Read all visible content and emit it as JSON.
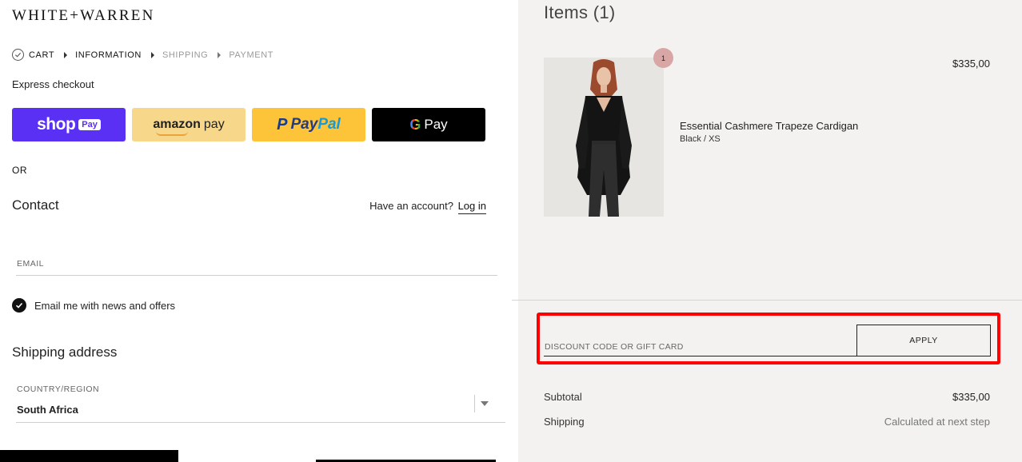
{
  "brand": {
    "logo_text": "WHITE+WARREN"
  },
  "breadcrumb": [
    {
      "label": "CART",
      "state": "done"
    },
    {
      "label": "INFORMATION",
      "state": "current"
    },
    {
      "label": "SHIPPING",
      "state": "future"
    },
    {
      "label": "PAYMENT",
      "state": "future"
    }
  ],
  "express": {
    "label": "Express checkout",
    "shop_pay": {
      "word": "shop",
      "tag": "Pay",
      "color": "#5a31f4"
    },
    "amazon_pay": {
      "word": "amazon",
      "pay": "pay",
      "color": "#f7d78a"
    },
    "paypal": {
      "word_a": "Pay",
      "word_b": "Pal",
      "color": "#fdc43a"
    },
    "google_pay": {
      "mark": "G",
      "word": "Pay",
      "color": "#000000"
    }
  },
  "or_label": "OR",
  "contact": {
    "heading": "Contact",
    "have_account": "Have an account?",
    "login_label": "Log in",
    "email_label": "EMAIL",
    "email_value": "",
    "newsletter_label": "Email me with news and offers",
    "newsletter_checked": true
  },
  "shipping": {
    "heading": "Shipping address",
    "country_label": "COUNTRY/REGION",
    "country_value": "South Africa"
  },
  "summary": {
    "items_heading": "Items (1)",
    "item": {
      "name": "Essential Cashmere Trapeze Cardigan",
      "variant": "Black / XS",
      "price": "$335,00",
      "quantity": "1"
    },
    "discount_placeholder": "DISCOUNT CODE OR GIFT CARD",
    "discount_value": "",
    "apply_label": "APPLY",
    "subtotal_label": "Subtotal",
    "subtotal_value": "$335,00",
    "shipping_label": "Shipping",
    "shipping_value": "Calculated at next step"
  },
  "colors": {
    "accent": "#111111",
    "summary_bg": "#f3f2f0",
    "highlight": "#ff0000"
  }
}
